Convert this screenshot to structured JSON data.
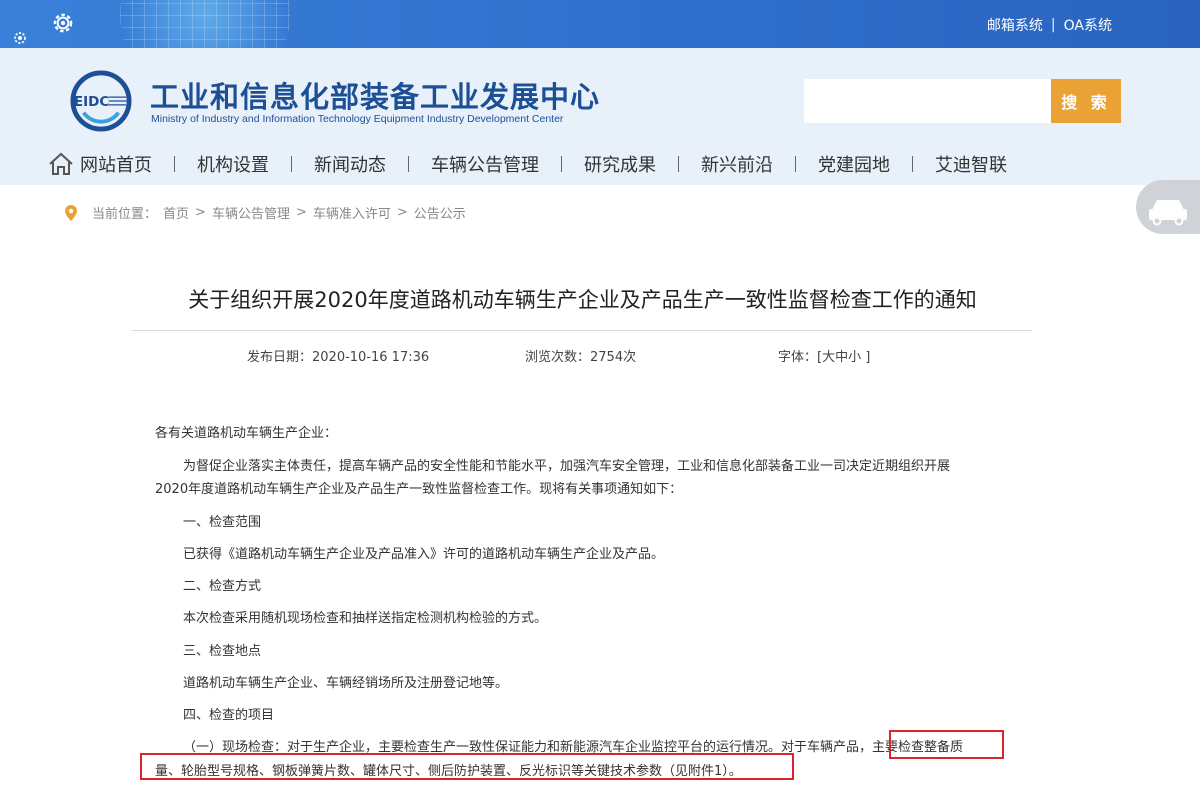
{
  "topbar": {
    "links": [
      "邮箱系统",
      "OA系统"
    ],
    "separator": "|"
  },
  "header": {
    "logo_mark_text": "EIDC",
    "org_name_cn": "工业和信息化部装备工业发展中心",
    "org_name_en": "Ministry of Industry and Information Technology Equipment Industry Development Center",
    "search": {
      "placeholder": "",
      "button_label": "搜 索"
    }
  },
  "nav": {
    "items": [
      "网站首页",
      "机构设置",
      "新闻动态",
      "车辆公告管理",
      "研究成果",
      "新兴前沿",
      "党建园地",
      "艾迪智联"
    ]
  },
  "breadcrumb": {
    "prefix": "当前位置：",
    "items": [
      "首页",
      "车辆公告管理",
      "车辆准入许可",
      "公告公示"
    ],
    "separator": ">"
  },
  "article": {
    "title": "关于组织开展2020年度道路机动车辆生产企业及产品生产一致性监督检查工作的通知",
    "publish_date": "发布日期：2020-10-16 17:36",
    "views": "浏览次数：2754次",
    "font_size_label": "字体：[大中小 ]",
    "paragraphs": [
      "各有关道路机动车辆生产企业：",
      "为督促企业落实主体责任，提高车辆产品的安全性能和节能水平，加强汽车安全管理，工业和信息化部装备工业一司决定近期组织开展",
      "2020年度道路机动车辆生产企业及产品生产一致性监督检查工作。现将有关事项通知如下：",
      "一、检查范围",
      "已获得《道路机动车辆生产企业及产品准入》许可的道路机动车辆生产企业及产品。",
      "二、检查方式",
      "本次检查采用随机现场检查和抽样送指定检测机构检验的方式。",
      "三、检查地点",
      "道路机动车辆生产企业、车辆经销场所及注册登记地等。",
      "四、检查的项目",
      "（一）现场检查：对于生产企业，主要检查生产一致性保证能力和新能源汽车企业监控平台的运行情况。对于车辆产品，主要检查整备质",
      "量、轮胎型号规格、钢板弹簧片数、罐体尺寸、侧后防护装置、反光标识等关键技术参数（见附件1）。"
    ]
  },
  "colors": {
    "topbar": "#2f6fcc",
    "header_bg": "#e8f1fa",
    "brand_text": "#1d4f96",
    "search_button": "#e9a233",
    "highlight_box": "#d8242a"
  }
}
